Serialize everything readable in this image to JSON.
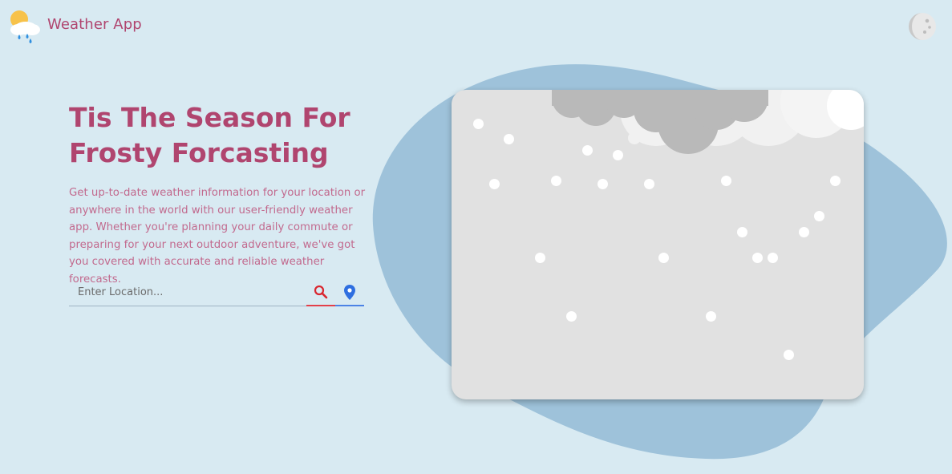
{
  "header": {
    "app_name": "Weather App",
    "logo_icon": "sun-cloud-rain-icon",
    "theme_toggle_icon": "moon-icon"
  },
  "hero": {
    "title_line1": "Tis The Season For",
    "title_line2": "Frosty Forcasting",
    "description": "Get up-to-date weather information for your location or anywhere in the world with our user-friendly weather app. Whether you're planning your daily commute or preparing for your next outdoor adventure, we've got you covered with accurate and reliable weather forecasts."
  },
  "search": {
    "placeholder": "Enter Location...",
    "value": "",
    "search_icon": "search-icon",
    "location_icon": "location-pin-icon"
  },
  "scene": {
    "type": "snow",
    "icon": "snow-clouds-icon"
  },
  "colors": {
    "background": "#d8eaf2",
    "accent": "#b0456f",
    "blob": "#9ec2da",
    "card": "#e1e1e1",
    "search_underline": "#e3404a",
    "location_underline": "#4c83e5"
  }
}
